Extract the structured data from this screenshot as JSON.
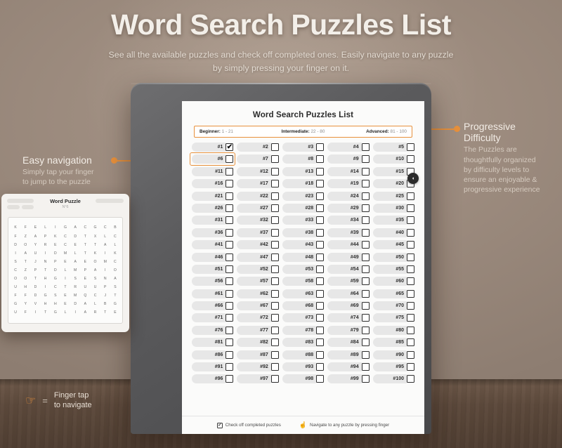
{
  "hero": {
    "title": "Word Search Puzzles List",
    "subtitle_line1": "See all the available puzzles and check off completed ones. Easily navigate to any puzzle",
    "subtitle_line2": "by simply pressing your finger on it."
  },
  "colors": {
    "accent": "#e8913c",
    "wall": "#9c8b7e",
    "desk": "#5d4a3c",
    "tablet_frame": "#5b5b5d",
    "screen": "#fbfbfa",
    "pill": "#e7e7e7",
    "text_dark": "#2b2b2b"
  },
  "screen": {
    "title": "Word Search Puzzles List",
    "difficulty": [
      {
        "label": "Beginner:",
        "range": "1 - 21"
      },
      {
        "label": "Intermediate:",
        "range": "22 - 80"
      },
      {
        "label": "Advanced:",
        "range": "81 - 100"
      }
    ],
    "puzzle_count": 100,
    "puzzle_prefix": "#",
    "checked": [
      1
    ],
    "selected": 6,
    "round_button_icon": "cursor-icon",
    "footer": [
      {
        "icon": "checkbox-icon",
        "label": "Check off completed puzzles"
      },
      {
        "icon": "hand-tap-icon",
        "label": "Navigate to any puzzle by pressing finger"
      }
    ]
  },
  "callout_left": {
    "title": "Easy navigation",
    "line1": "Simply tap your finger",
    "line2": "to jump to the puzzle"
  },
  "callout_right": {
    "title_line1": "Progressive",
    "title_line2": "Difficulty",
    "body_line1": "The Puzzles are",
    "body_line2": "thoughtfully organized",
    "body_line3": "by difficulty levels to",
    "body_line4": "ensure an enjoyable &",
    "body_line5": "progressive experience"
  },
  "card": {
    "title": "Word Puzzle",
    "number": "N°6",
    "letters": [
      "K",
      "F",
      "E",
      "L",
      "I",
      "G",
      "A",
      "C",
      "G",
      "C",
      "B",
      "F",
      "Z",
      "A",
      "P",
      "K",
      "C",
      "D",
      "T",
      "X",
      "L",
      "C",
      "D",
      "O",
      "Y",
      "R",
      "E",
      "C",
      "E",
      "T",
      "T",
      "A",
      "L",
      "I",
      "A",
      "U",
      "I",
      "D",
      "M",
      "L",
      "T",
      "K",
      "I",
      "K",
      "S",
      "T",
      "J",
      "N",
      "P",
      "E",
      "A",
      "E",
      "O",
      "M",
      "C",
      "C",
      "Z",
      "P",
      "T",
      "D",
      "L",
      "M",
      "P",
      "A",
      "I",
      "O",
      "O",
      "O",
      "T",
      "H",
      "G",
      "I",
      "S",
      "E",
      "S",
      "N",
      "A",
      "U",
      "H",
      "D",
      "I",
      "C",
      "T",
      "R",
      "U",
      "U",
      "P",
      "S",
      "F",
      "F",
      "D",
      "G",
      "S",
      "E",
      "M",
      "Q",
      "C",
      "J",
      "T",
      "G",
      "Y",
      "V",
      "H",
      "H",
      "E",
      "D",
      "A",
      "L",
      "B",
      "G",
      "U",
      "F",
      "I",
      "T",
      "G",
      "L",
      "I",
      "A",
      "R",
      "T",
      "E"
    ]
  },
  "finger_legend": {
    "icon": "hand-tap-icon",
    "equals": "=",
    "line1": "Finger tap",
    "line2": "to navigate"
  }
}
